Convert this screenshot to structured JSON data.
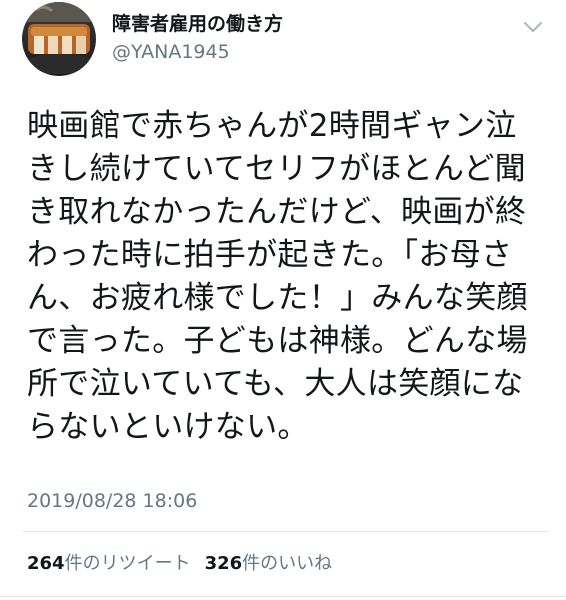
{
  "tweet": {
    "display_name": "障害者雇用の働き方",
    "handle": "@YANA1945",
    "text": "映画館で赤ちゃんが2時間ギャン泣\nきし続けていてセリフがほとんど聞\nき取れなかったんだけど、映画が終\nわった時に拍手が起きた。「お母さ\nん、お疲れ様でした！」みんな笑顔\nで言った。子どもは神様。どんな場\n所で泣いていても、大人は笑顔にな\nらないといけない。",
    "timestamp": "2019/08/28 18:06",
    "retweet_count": "264",
    "retweet_label": "件のリツイート",
    "like_count": "326",
    "like_label": "件のいいね"
  },
  "icons": {
    "avatar": "profile-photo-food",
    "menu": "chevron-down-icon"
  },
  "colors": {
    "primary_text": "#14171a",
    "secondary_text": "#657786",
    "divider": "#e1e8ed"
  }
}
